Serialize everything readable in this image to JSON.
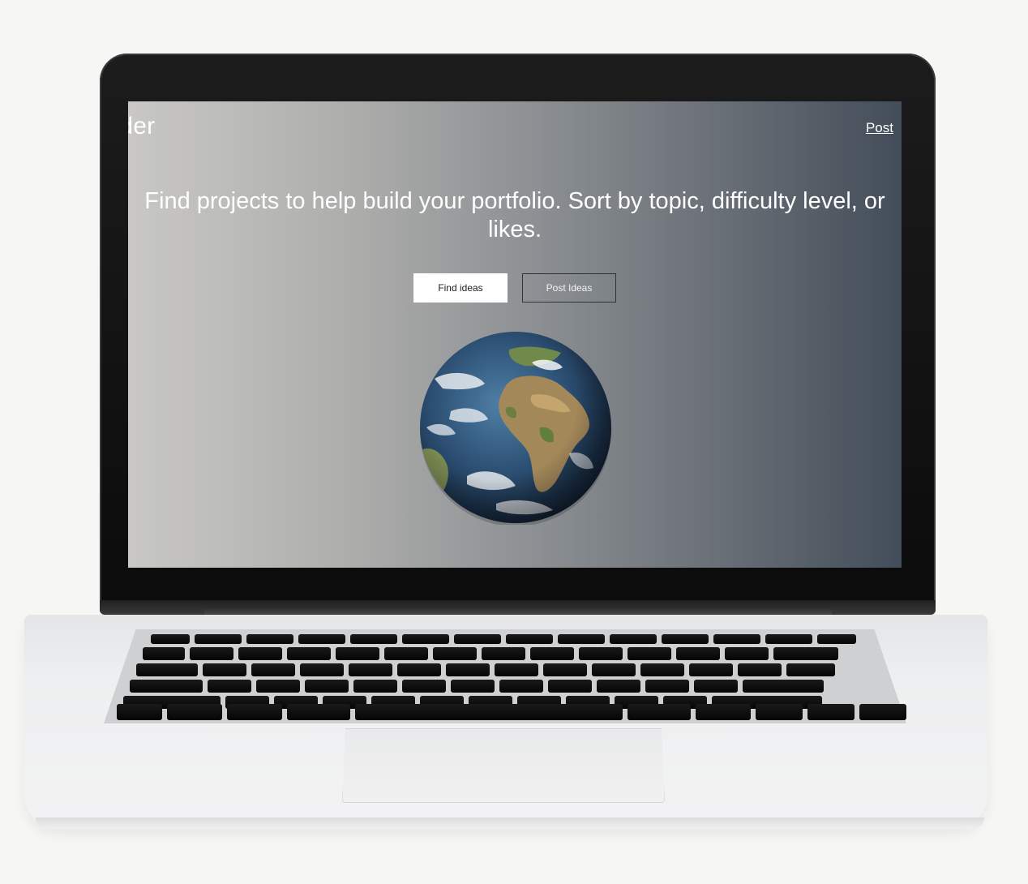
{
  "header": {
    "brand": "t Finder",
    "post_link": "Post"
  },
  "hero": {
    "headline": "Find projects to help build your portfolio. Sort by topic, difficulty level, or likes.",
    "find_button": "Find ideas",
    "post_button": "Post Ideas"
  },
  "icons": {
    "globe": "earth-globe-icon"
  },
  "colors": {
    "gradient_start": "#c9c8c4",
    "gradient_end": "#434d59",
    "primary_button_bg": "#ffffff"
  }
}
